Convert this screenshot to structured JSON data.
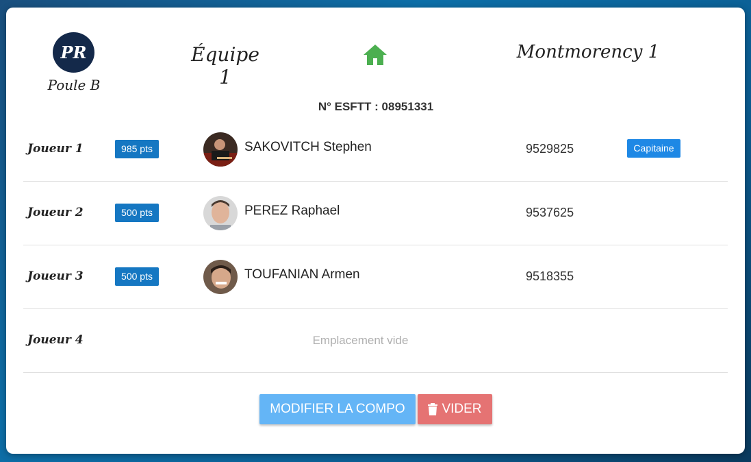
{
  "header": {
    "initials": "PR",
    "poule": "Poule B",
    "team": "Équipe 1",
    "venue_icon": "home-icon",
    "opponent": "Montmorency 1",
    "esftt": "N° ESFTT : 08951331"
  },
  "players": [
    {
      "label": "Joueur 1",
      "points": "985 pts",
      "name": "SAKOVITCH Stephen",
      "licence": "9529825",
      "badge": "Capitaine"
    },
    {
      "label": "Joueur 2",
      "points": "500 pts",
      "name": "PEREZ Raphael",
      "licence": "9537625",
      "badge": ""
    },
    {
      "label": "Joueur 3",
      "points": "500 pts",
      "name": "TOUFANIAN Armen",
      "licence": "9518355",
      "badge": ""
    },
    {
      "label": "Joueur 4",
      "empty": "Emplacement vide"
    }
  ],
  "actions": {
    "modify": "MODIFIER LA COMPO",
    "clear": "VIDER"
  },
  "colors": {
    "points_badge": "#1577c2",
    "captain_badge": "#1e88e5",
    "home_icon": "#4caf50",
    "modify_button": "#64b5f6",
    "clear_button": "#e57373"
  }
}
